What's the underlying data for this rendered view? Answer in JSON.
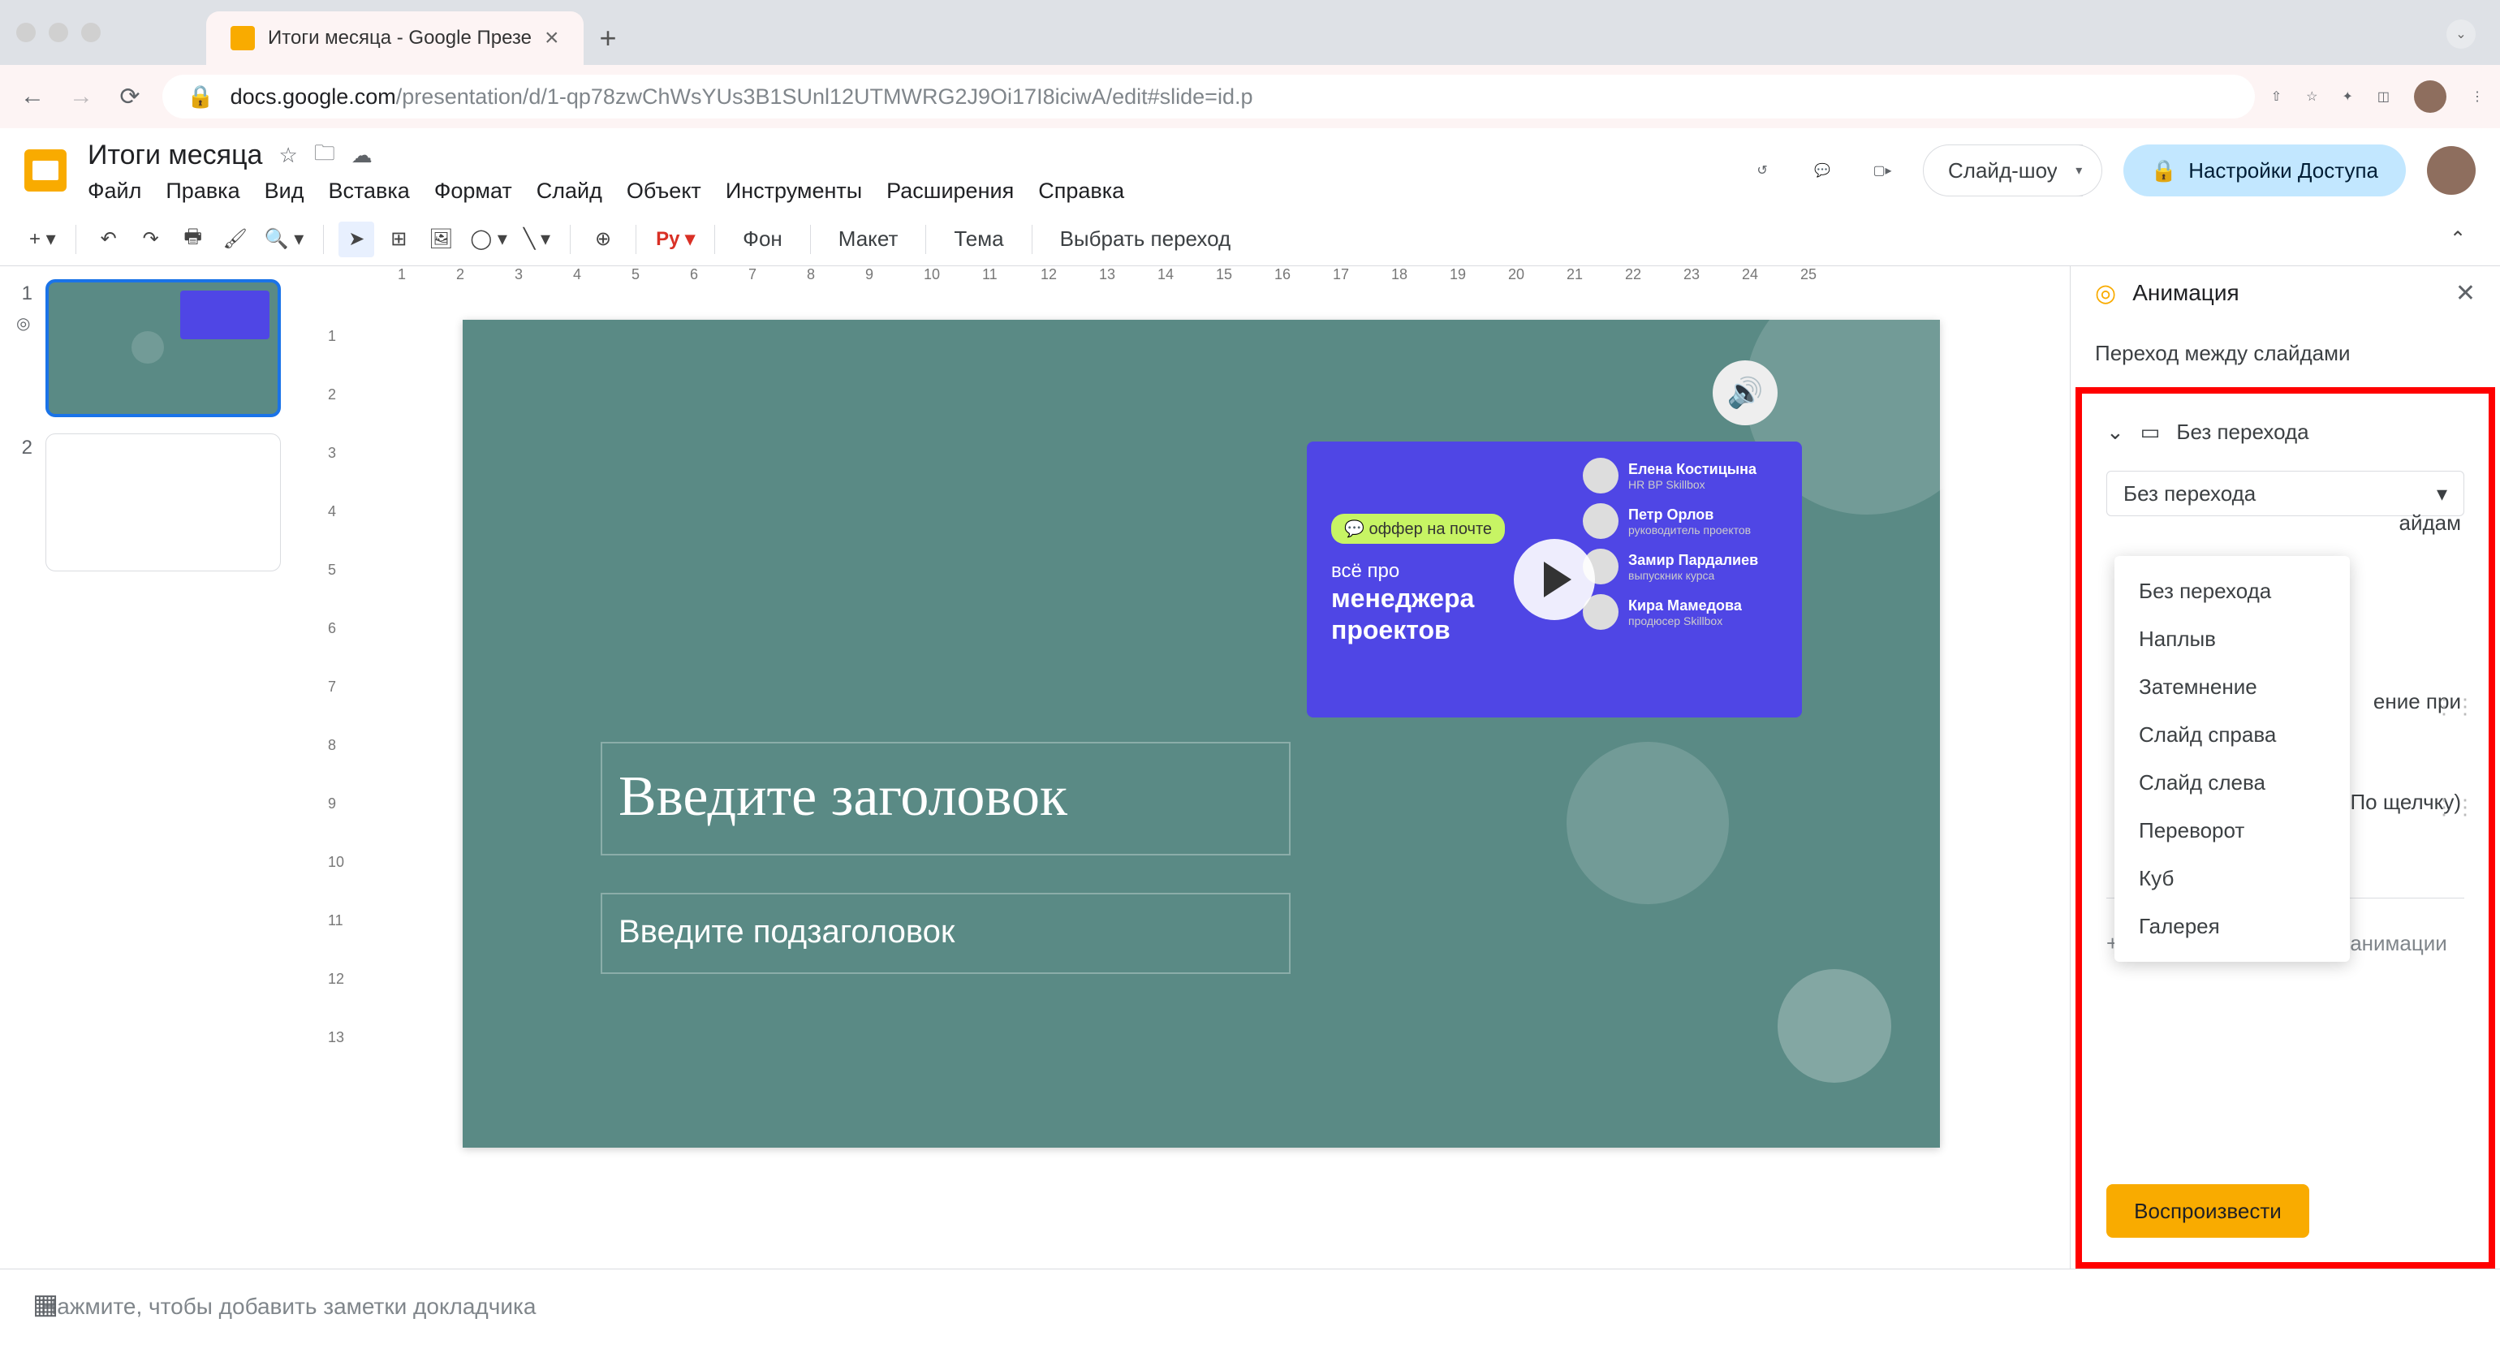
{
  "browser": {
    "tab_title": "Итоги месяца - Google Презе",
    "url_host": "docs.google.com",
    "url_path": "/presentation/d/1-qp78zwChWsYUs3B1SUnl12UTMWRG2J9Oi17I8iciwA/edit#slide=id.p"
  },
  "doc": {
    "title": "Итоги месяца",
    "menu": [
      "Файл",
      "Правка",
      "Вид",
      "Вставка",
      "Формат",
      "Слайд",
      "Объект",
      "Инструменты",
      "Расширения",
      "Справка"
    ],
    "slideshow_btn": "Слайд-шоу",
    "share_btn": "Настройки Доступа"
  },
  "toolbar": {
    "background": "Фон",
    "layout": "Макет",
    "theme": "Тема",
    "transition": "Выбрать переход"
  },
  "thumbs": {
    "n1": "1",
    "n2": "2"
  },
  "ruler_h": [
    "1",
    "2",
    "3",
    "4",
    "5",
    "6",
    "7",
    "8",
    "9",
    "10",
    "11",
    "12",
    "13",
    "14",
    "15",
    "16",
    "17",
    "18",
    "19",
    "20",
    "21",
    "22",
    "23",
    "24",
    "25"
  ],
  "ruler_v": [
    "1",
    "2",
    "3",
    "4",
    "5",
    "6",
    "7",
    "8",
    "9",
    "10",
    "11",
    "12",
    "13"
  ],
  "slide": {
    "title_ph": "Введите заголовок",
    "sub_ph": "Введите подзаголовок",
    "video_badge": "оффер на почте",
    "video_line1": "всё про",
    "video_line2": "менеджера",
    "video_line3": "проектов",
    "people": [
      {
        "name": "Елена Костицына",
        "role": "HR BP Skillbox"
      },
      {
        "name": "Петр Орлов",
        "role": "руководитель проектов"
      },
      {
        "name": "Замир Пардалиев",
        "role": "выпускник курса"
      },
      {
        "name": "Кира Мамедова",
        "role": "продюсер Skillbox"
      }
    ]
  },
  "notes": {
    "placeholder": "Нажмите, чтобы добавить заметки докладчика"
  },
  "anim": {
    "title": "Анимация",
    "subhead": "Переход между слайдами",
    "current_trans": "Без перехода",
    "dd_selected": "Без перехода",
    "options": [
      "Без перехода",
      "Наплыв",
      "Затемнение",
      "Слайд справа",
      "Слайд слева",
      "Переворот",
      "Куб",
      "Галерея"
    ],
    "behind_right1": "айдам",
    "behind_right2": "ение при",
    "behind_right3": "По щелчку)",
    "add_label": "Выберите объект для анимации",
    "play": "Воспроизвести"
  }
}
